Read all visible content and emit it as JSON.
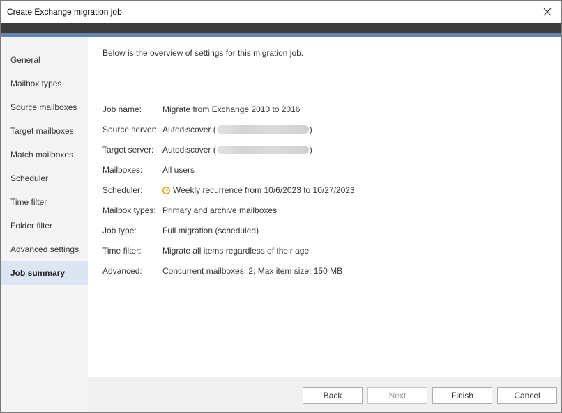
{
  "window": {
    "title": "Create Exchange migration job"
  },
  "sidebar": {
    "items": [
      {
        "label": "General",
        "active": false
      },
      {
        "label": "Mailbox types",
        "active": false
      },
      {
        "label": "Source mailboxes",
        "active": false
      },
      {
        "label": "Target mailboxes",
        "active": false
      },
      {
        "label": "Match mailboxes",
        "active": false
      },
      {
        "label": "Scheduler",
        "active": false
      },
      {
        "label": "Time filter",
        "active": false
      },
      {
        "label": "Folder filter",
        "active": false
      },
      {
        "label": "Advanced settings",
        "active": false
      },
      {
        "label": "Job summary",
        "active": true
      }
    ]
  },
  "summary": {
    "intro": "Below is the overview of settings for this migration job.",
    "rows": [
      {
        "label": "Job name:",
        "value": "Migrate from Exchange 2010 to 2016"
      },
      {
        "label": "Source server:",
        "value": "Autodiscover (",
        "suffix": ")"
      },
      {
        "label": "Target server:",
        "value": "Autodiscover (",
        "suffix": ")"
      },
      {
        "label": "Mailboxes:",
        "value": "All users"
      },
      {
        "label": "Scheduler:",
        "value": "Weekly recurrence from 10/6/2023 to 10/27/2023",
        "icon": "clock-icon"
      },
      {
        "label": "Mailbox types:",
        "value": "Primary and archive mailboxes"
      },
      {
        "label": "Job type:",
        "value": "Full migration (scheduled)"
      },
      {
        "label": "Time filter:",
        "value": "Migrate all items regardless of their age"
      },
      {
        "label": "Advanced:",
        "value": "Concurrent mailboxes: 2; Max item size: 150 MB"
      }
    ]
  },
  "footer": {
    "back_label": "Back",
    "next_label": "Next",
    "finish_label": "Finish",
    "cancel_label": "Cancel"
  },
  "colors": {
    "accent_blue": "#6584ad",
    "divider": "#3e5f88",
    "active_nav": "#dbe6f2",
    "clock_icon": "#e8a417"
  }
}
